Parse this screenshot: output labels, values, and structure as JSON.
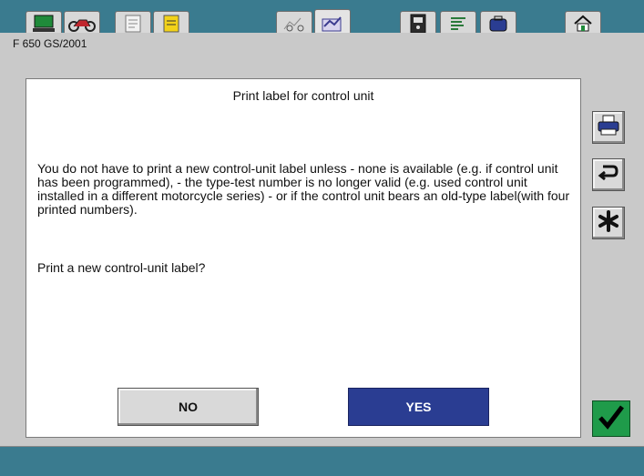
{
  "header": {
    "model": "F 650 GS/2001",
    "tabs": [
      {
        "icon": "laptop-icon"
      },
      {
        "icon": "motorcycle-icon"
      },
      {
        "icon": "document-list-icon"
      },
      {
        "icon": "notepad-icon"
      },
      {
        "icon": "chart-motorcycle-icon"
      },
      {
        "icon": "chart-box-icon"
      },
      {
        "icon": "control-unit-icon"
      },
      {
        "icon": "list-lines-icon"
      },
      {
        "icon": "folder-icon"
      },
      {
        "icon": "home-icon"
      }
    ]
  },
  "dialog": {
    "title": "Print label for control unit",
    "body": " You do not have to print a new control-unit label unless - none is available (e.g. if control unit has been programmed), - the type-test number is no longer valid (e.g. used control unit installed in a different motorcycle series) - or if the control unit bears an old-type label(with four printed numbers).",
    "question": "Print a new control-unit label?",
    "no_label": "NO",
    "yes_label": "YES"
  },
  "side_buttons": [
    "printer-icon",
    "return-icon",
    "asterisk-icon"
  ],
  "colors": {
    "background": "#3a7b8f",
    "panel": "#c9c9c9",
    "yes_button": "#2a3d92",
    "ok_button": "#1f9b4a"
  }
}
